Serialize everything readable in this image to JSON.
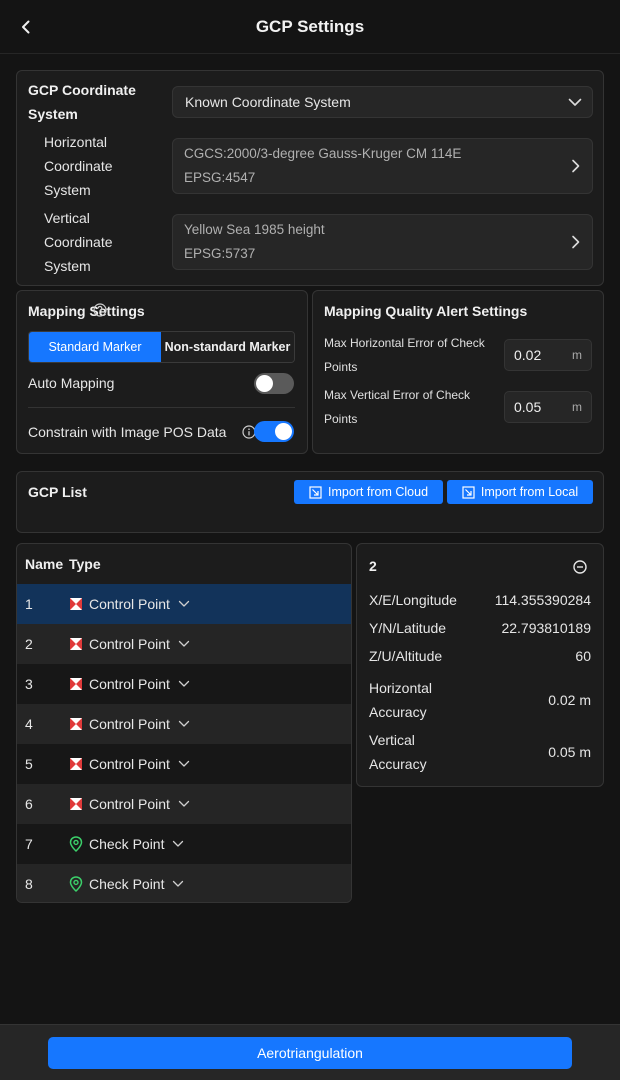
{
  "header": {
    "title": "GCP Settings"
  },
  "coord_system": {
    "label": "GCP Coordinate System",
    "selected": "Known Coordinate System",
    "horizontal": {
      "label": "Horizontal Coordinate System",
      "line1": "CGCS:2000/3-degree Gauss-Kruger CM 114E",
      "line2": "EPSG:4547"
    },
    "vertical": {
      "label": "Vertical Coordinate System",
      "line1": "Yellow Sea 1985 height",
      "line2": "EPSG:5737"
    }
  },
  "mapping": {
    "title": "Mapping Settings",
    "standard_label": "Standard Marker",
    "nonstandard_label": "Non-standard Marker",
    "auto_label": "Auto Mapping",
    "auto_on": false,
    "constrain_label": "Constrain with Image POS Data",
    "constrain_on": true
  },
  "quality": {
    "title": "Mapping Quality Alert Settings",
    "h_label": "Max Horizontal Error of Check Points",
    "h_value": "0.02",
    "v_label": "Max Vertical Error of Check Points",
    "v_value": "0.05",
    "unit": "m"
  },
  "gcp_list": {
    "title": "GCP List",
    "import_cloud": "Import from Cloud",
    "import_local": "Import from Local"
  },
  "table": {
    "col_name": "Name",
    "col_type": "Type",
    "rows": [
      {
        "name": "1",
        "type": "Control Point",
        "icon": "control-point-icon",
        "selected": true
      },
      {
        "name": "2",
        "type": "Control Point",
        "icon": "control-point-icon"
      },
      {
        "name": "3",
        "type": "Control Point",
        "icon": "control-point-icon"
      },
      {
        "name": "4",
        "type": "Control Point",
        "icon": "control-point-icon"
      },
      {
        "name": "5",
        "type": "Control Point",
        "icon": "control-point-icon"
      },
      {
        "name": "6",
        "type": "Control Point",
        "icon": "control-point-icon"
      },
      {
        "name": "7",
        "type": "Check Point",
        "icon": "check-point-icon"
      },
      {
        "name": "8",
        "type": "Check Point",
        "icon": "check-point-icon"
      }
    ]
  },
  "detail": {
    "id": "2",
    "x_label": "X/E/Longitude",
    "x_value": "114.355390284",
    "y_label": "Y/N/Latitude",
    "y_value": "22.793810189",
    "z_label": "Z/U/Altitude",
    "z_value": "60",
    "h_label_1": "Horizontal",
    "h_label_2": "Accuracy",
    "h_value": "0.02 m",
    "v_label_1": "Vertical",
    "v_label_2": "Accuracy",
    "v_value": "0.05 m"
  },
  "footer": {
    "button": "Aerotriangulation"
  },
  "colors": {
    "accent": "#1677ff",
    "control_red": "#e03a3a",
    "check_green": "#3ccf6a",
    "selected_row": "#12335a"
  }
}
